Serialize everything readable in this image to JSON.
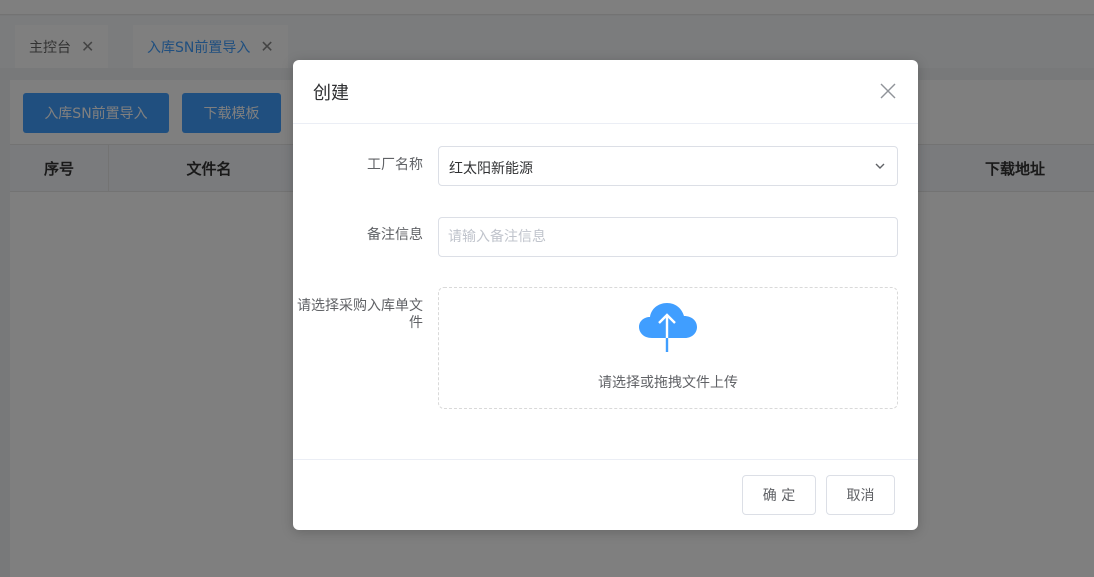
{
  "tabs": [
    {
      "label": "主控台",
      "close_icon": "close-icon"
    },
    {
      "label": "入库SN前置导入",
      "close_icon": "close-icon"
    }
  ],
  "toolbar": {
    "import_label": "入库SN前置导入",
    "download_label": "下载模板"
  },
  "table": {
    "columns": [
      "序号",
      "文件名",
      "下载地址"
    ]
  },
  "dialog": {
    "title": "创建",
    "fields": {
      "factory": {
        "label": "工厂名称",
        "value": "红太阳新能源"
      },
      "remark": {
        "label": "备注信息",
        "placeholder": "请输入备注信息"
      },
      "file": {
        "label": "请选择采购入库单文件",
        "upload_text": "请选择或拖拽文件上传"
      }
    },
    "ok_label": "确 定",
    "cancel_label": "取消"
  },
  "colors": {
    "primary": "#409eff",
    "upload_icon": "#409eff"
  }
}
